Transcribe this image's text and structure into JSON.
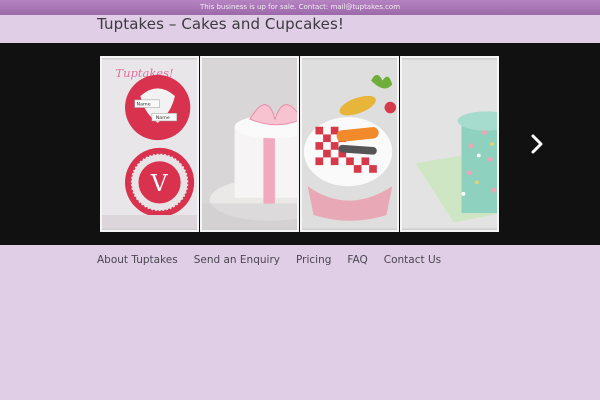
{
  "topbar": {
    "text": "This business is up for sale. Contact: mail@tuptakes.com"
  },
  "header": {
    "title": "Tuptakes – Cakes and Cupcakes!"
  },
  "slider": {
    "slides": [
      {
        "name": "cupcakes-heart-v",
        "logo_text": "Tuptakes!",
        "tag1": "Name",
        "tag2": "Name",
        "letter": "V"
      },
      {
        "name": "pink-bow-cake"
      },
      {
        "name": "vegetable-cupcake"
      },
      {
        "name": "mint-polka-cake"
      }
    ],
    "next_icon": "chevron-right-icon"
  },
  "nav": {
    "items": [
      {
        "label": "About Tuptakes"
      },
      {
        "label": "Send an Enquiry"
      },
      {
        "label": "Pricing"
      },
      {
        "label": "FAQ"
      },
      {
        "label": "Contact Us"
      }
    ]
  },
  "colors": {
    "background": "#e0cde6",
    "topbar": "#a775b3",
    "slider_bg": "#111111"
  }
}
